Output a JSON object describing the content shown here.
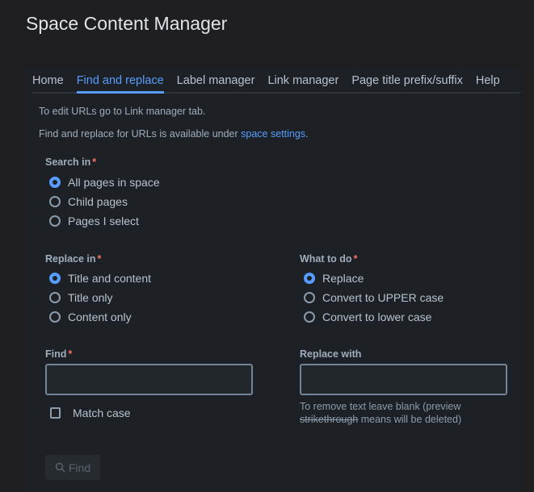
{
  "title": "Space Content Manager",
  "tabs": [
    "Home",
    "Find and replace",
    "Label manager",
    "Link manager",
    "Page title prefix/suffix",
    "Help"
  ],
  "active_tab": "Find and replace",
  "info1": "To edit URLs go to Link manager tab.",
  "info2_pre": "Find and replace for URLs is available under ",
  "info2_link": "space settings",
  "info2_post": ".",
  "search_in": {
    "label": "Search in",
    "required": "*",
    "options": [
      "All pages in space",
      "Child pages",
      "Pages I select"
    ],
    "selected": 0
  },
  "replace_in": {
    "label": "Replace in",
    "required": "*",
    "options": [
      "Title and content",
      "Title only",
      "Content only"
    ],
    "selected": 0
  },
  "what_to_do": {
    "label": "What to do",
    "required": "*",
    "options": [
      "Replace",
      "Convert to UPPER case",
      "Convert to lower case"
    ],
    "selected": 0
  },
  "find": {
    "label": "Find",
    "required": "*",
    "value": ""
  },
  "replace_with": {
    "label": "Replace with",
    "value": "",
    "help_pre": "To remove text leave blank (preview ",
    "help_strike": "strikethrough",
    "help_post": " means will be deleted)"
  },
  "match_case": {
    "label": "Match case",
    "checked": false
  },
  "find_button": "Find"
}
